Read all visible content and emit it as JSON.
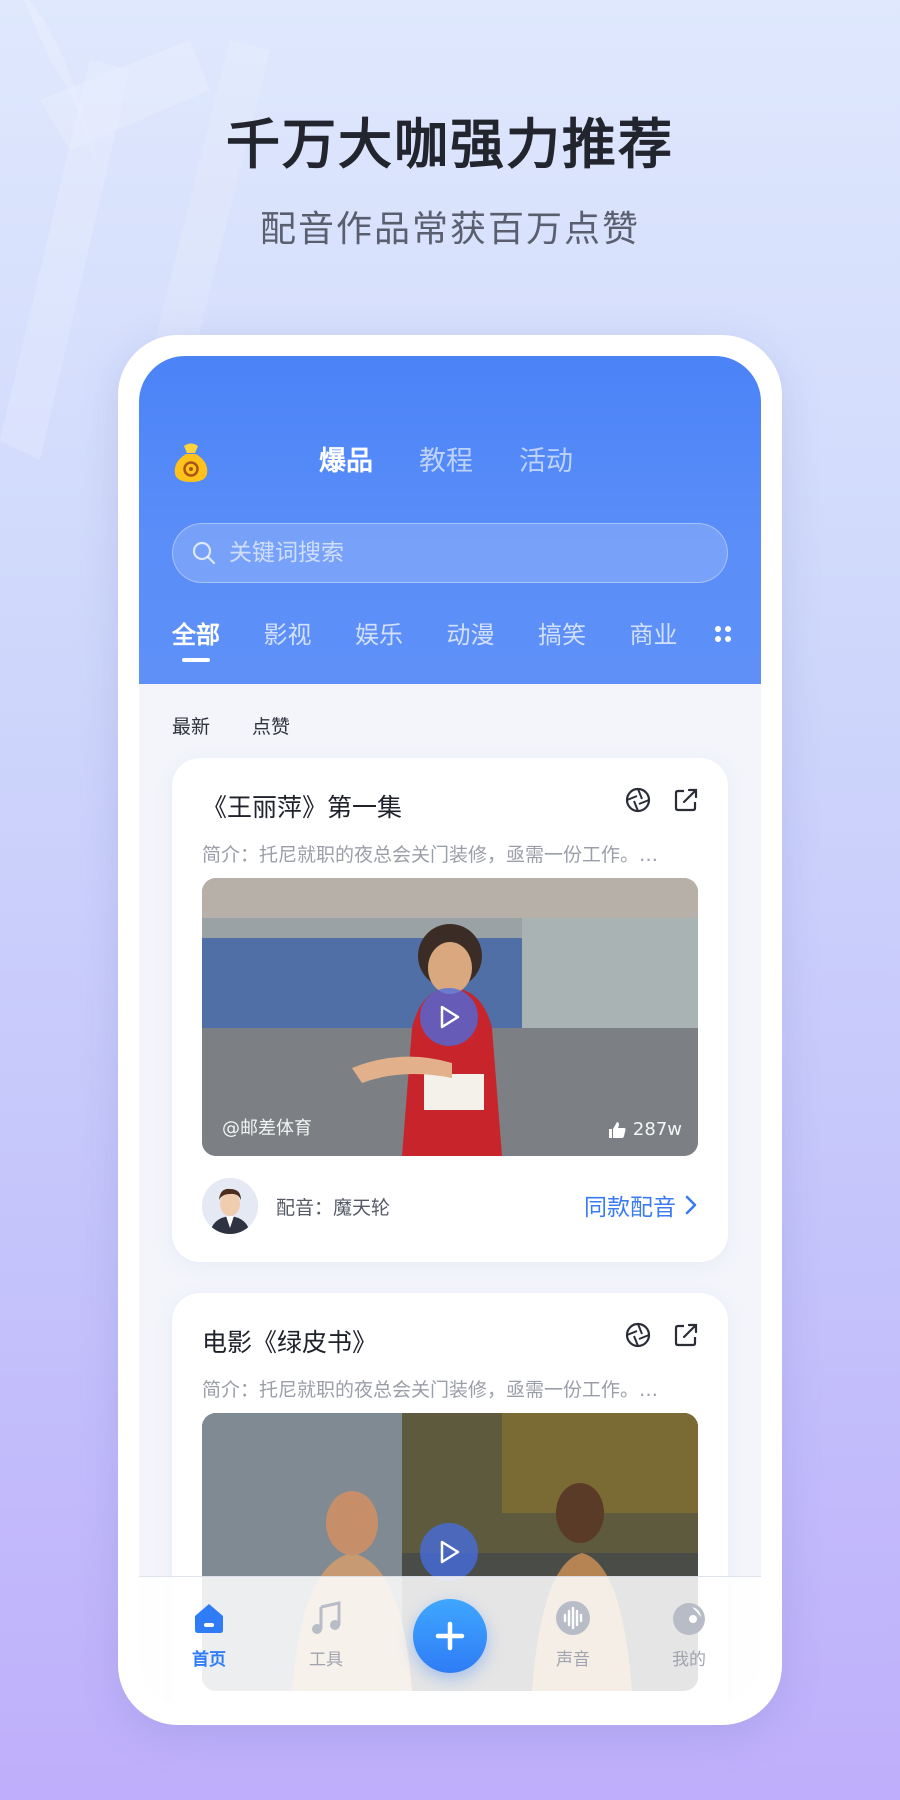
{
  "promo": {
    "headline": "千万大咖强力推荐",
    "subline": "配音作品常获百万点赞"
  },
  "header": {
    "tabs": [
      {
        "label": "爆品",
        "active": true
      },
      {
        "label": "教程",
        "active": false
      },
      {
        "label": "活动",
        "active": false
      }
    ],
    "search_placeholder": "关键词搜索"
  },
  "categories": [
    {
      "label": "全部",
      "active": true
    },
    {
      "label": "影视"
    },
    {
      "label": "娱乐"
    },
    {
      "label": "动漫"
    },
    {
      "label": "搞笑"
    },
    {
      "label": "商业"
    }
  ],
  "sort": {
    "latest": "最新",
    "likes": "点赞"
  },
  "cards": [
    {
      "title": "《王丽萍》第一集",
      "desc": "简介：托尼就职的夜总会关门装修，亟需一份工作。…",
      "thumb_author": "@邮差体育",
      "likes": "287w",
      "dubber": "配音：魔天轮",
      "same_label": "同款配音"
    },
    {
      "title": "电影《绿皮书》",
      "desc": "简介：托尼就职的夜总会关门装修，亟需一份工作。…"
    }
  ],
  "tabbar": {
    "home": "首页",
    "tools": "工具",
    "voice": "声音",
    "mine": "我的"
  },
  "colors": {
    "accent": "#2f7cf6",
    "header_bg": "#4b83f7",
    "page_bg_top": "#dfe8fd",
    "page_bg_bottom": "#bfaefb"
  }
}
